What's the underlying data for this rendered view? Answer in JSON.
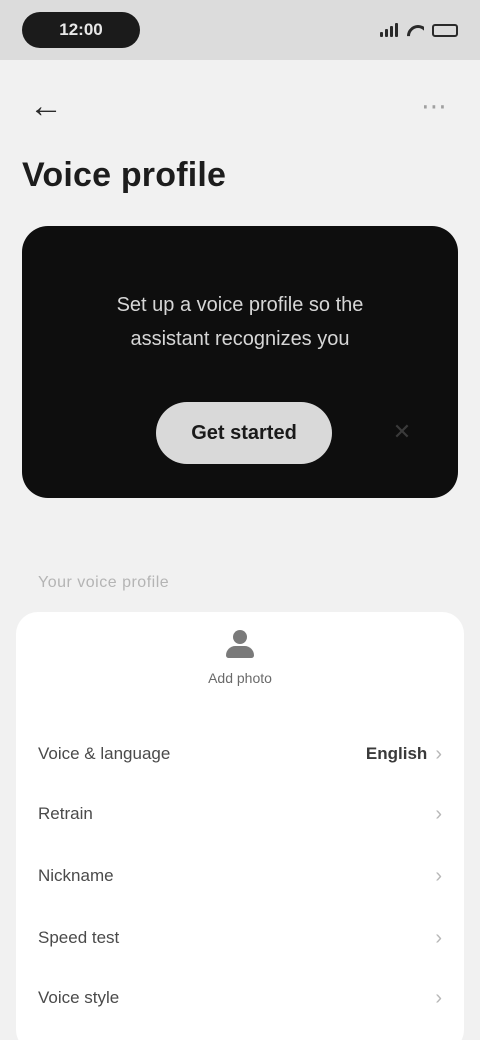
{
  "status_bar": {
    "time": "12:00",
    "icons": [
      "signal-icon",
      "wifi-icon",
      "battery-icon"
    ]
  },
  "nav": {
    "back_icon": "back-arrow-icon",
    "back_glyph": "←",
    "more_icon": "more-icon",
    "more_glyph": "⋯"
  },
  "page": {
    "title": "Voice profile"
  },
  "promo": {
    "text": "Set up a voice profile so the assistant recognizes you",
    "button_label": "Get started",
    "close_glyph": "✕"
  },
  "section": {
    "header": "Your voice profile"
  },
  "profile": {
    "avatar_label": "Add photo",
    "rows": [
      {
        "label": "Voice & language",
        "value": "English",
        "chevron": "›"
      },
      {
        "label": "Retrain",
        "value": "",
        "chevron": "›"
      },
      {
        "label": "Nickname",
        "value": "",
        "chevron": "›"
      },
      {
        "label": "Speed test",
        "value": "",
        "chevron": "›"
      },
      {
        "label": "Voice style",
        "value": "",
        "chevron": "›"
      }
    ]
  },
  "colors": {
    "background": "#f1f1f1",
    "card": "#ffffff",
    "promo": "#0e0e0e",
    "accent": "#1d1d1d"
  }
}
